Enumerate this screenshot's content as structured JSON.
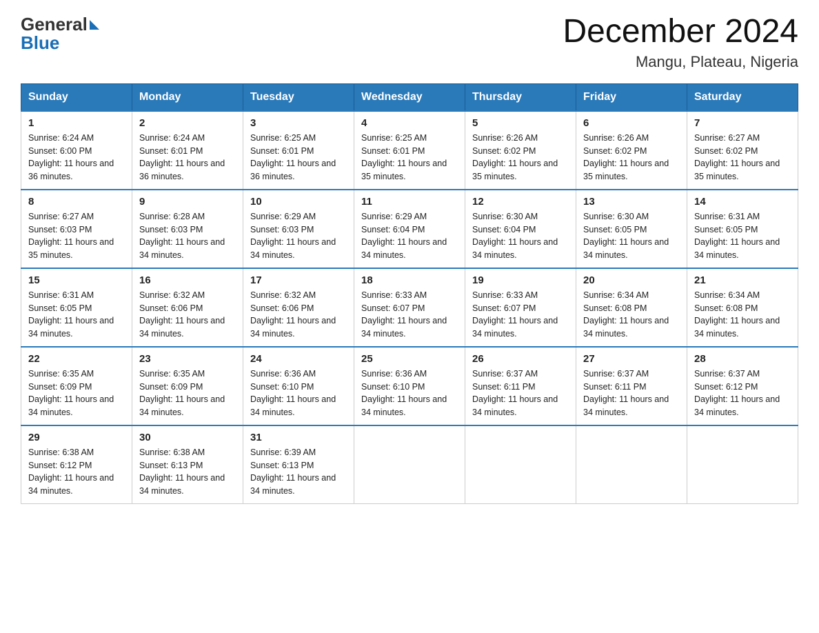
{
  "header": {
    "logo_general": "General",
    "logo_blue": "Blue",
    "month_title": "December 2024",
    "location": "Mangu, Plateau, Nigeria"
  },
  "weekdays": [
    "Sunday",
    "Monday",
    "Tuesday",
    "Wednesday",
    "Thursday",
    "Friday",
    "Saturday"
  ],
  "weeks": [
    [
      {
        "day": "1",
        "sunrise": "6:24 AM",
        "sunset": "6:00 PM",
        "daylight": "11 hours and 36 minutes."
      },
      {
        "day": "2",
        "sunrise": "6:24 AM",
        "sunset": "6:01 PM",
        "daylight": "11 hours and 36 minutes."
      },
      {
        "day": "3",
        "sunrise": "6:25 AM",
        "sunset": "6:01 PM",
        "daylight": "11 hours and 36 minutes."
      },
      {
        "day": "4",
        "sunrise": "6:25 AM",
        "sunset": "6:01 PM",
        "daylight": "11 hours and 35 minutes."
      },
      {
        "day": "5",
        "sunrise": "6:26 AM",
        "sunset": "6:02 PM",
        "daylight": "11 hours and 35 minutes."
      },
      {
        "day": "6",
        "sunrise": "6:26 AM",
        "sunset": "6:02 PM",
        "daylight": "11 hours and 35 minutes."
      },
      {
        "day": "7",
        "sunrise": "6:27 AM",
        "sunset": "6:02 PM",
        "daylight": "11 hours and 35 minutes."
      }
    ],
    [
      {
        "day": "8",
        "sunrise": "6:27 AM",
        "sunset": "6:03 PM",
        "daylight": "11 hours and 35 minutes."
      },
      {
        "day": "9",
        "sunrise": "6:28 AM",
        "sunset": "6:03 PM",
        "daylight": "11 hours and 34 minutes."
      },
      {
        "day": "10",
        "sunrise": "6:29 AM",
        "sunset": "6:03 PM",
        "daylight": "11 hours and 34 minutes."
      },
      {
        "day": "11",
        "sunrise": "6:29 AM",
        "sunset": "6:04 PM",
        "daylight": "11 hours and 34 minutes."
      },
      {
        "day": "12",
        "sunrise": "6:30 AM",
        "sunset": "6:04 PM",
        "daylight": "11 hours and 34 minutes."
      },
      {
        "day": "13",
        "sunrise": "6:30 AM",
        "sunset": "6:05 PM",
        "daylight": "11 hours and 34 minutes."
      },
      {
        "day": "14",
        "sunrise": "6:31 AM",
        "sunset": "6:05 PM",
        "daylight": "11 hours and 34 minutes."
      }
    ],
    [
      {
        "day": "15",
        "sunrise": "6:31 AM",
        "sunset": "6:05 PM",
        "daylight": "11 hours and 34 minutes."
      },
      {
        "day": "16",
        "sunrise": "6:32 AM",
        "sunset": "6:06 PM",
        "daylight": "11 hours and 34 minutes."
      },
      {
        "day": "17",
        "sunrise": "6:32 AM",
        "sunset": "6:06 PM",
        "daylight": "11 hours and 34 minutes."
      },
      {
        "day": "18",
        "sunrise": "6:33 AM",
        "sunset": "6:07 PM",
        "daylight": "11 hours and 34 minutes."
      },
      {
        "day": "19",
        "sunrise": "6:33 AM",
        "sunset": "6:07 PM",
        "daylight": "11 hours and 34 minutes."
      },
      {
        "day": "20",
        "sunrise": "6:34 AM",
        "sunset": "6:08 PM",
        "daylight": "11 hours and 34 minutes."
      },
      {
        "day": "21",
        "sunrise": "6:34 AM",
        "sunset": "6:08 PM",
        "daylight": "11 hours and 34 minutes."
      }
    ],
    [
      {
        "day": "22",
        "sunrise": "6:35 AM",
        "sunset": "6:09 PM",
        "daylight": "11 hours and 34 minutes."
      },
      {
        "day": "23",
        "sunrise": "6:35 AM",
        "sunset": "6:09 PM",
        "daylight": "11 hours and 34 minutes."
      },
      {
        "day": "24",
        "sunrise": "6:36 AM",
        "sunset": "6:10 PM",
        "daylight": "11 hours and 34 minutes."
      },
      {
        "day": "25",
        "sunrise": "6:36 AM",
        "sunset": "6:10 PM",
        "daylight": "11 hours and 34 minutes."
      },
      {
        "day": "26",
        "sunrise": "6:37 AM",
        "sunset": "6:11 PM",
        "daylight": "11 hours and 34 minutes."
      },
      {
        "day": "27",
        "sunrise": "6:37 AM",
        "sunset": "6:11 PM",
        "daylight": "11 hours and 34 minutes."
      },
      {
        "day": "28",
        "sunrise": "6:37 AM",
        "sunset": "6:12 PM",
        "daylight": "11 hours and 34 minutes."
      }
    ],
    [
      {
        "day": "29",
        "sunrise": "6:38 AM",
        "sunset": "6:12 PM",
        "daylight": "11 hours and 34 minutes."
      },
      {
        "day": "30",
        "sunrise": "6:38 AM",
        "sunset": "6:13 PM",
        "daylight": "11 hours and 34 minutes."
      },
      {
        "day": "31",
        "sunrise": "6:39 AM",
        "sunset": "6:13 PM",
        "daylight": "11 hours and 34 minutes."
      },
      null,
      null,
      null,
      null
    ]
  ],
  "labels": {
    "sunrise": "Sunrise:",
    "sunset": "Sunset:",
    "daylight": "Daylight:"
  }
}
